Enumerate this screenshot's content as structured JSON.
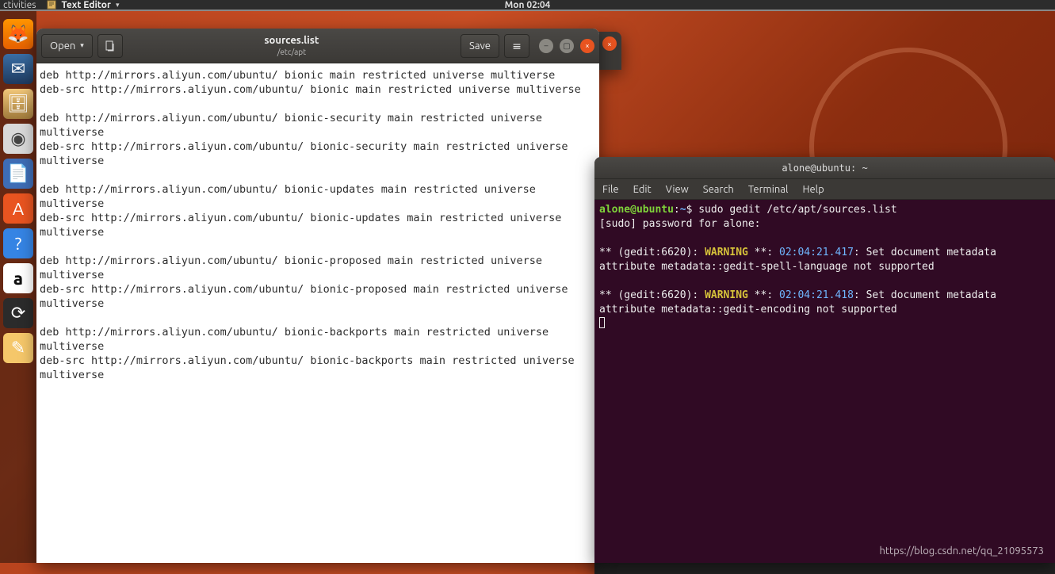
{
  "topbar": {
    "activities": "ctivities",
    "app": "Text Editor",
    "clock": "Mon 02:04"
  },
  "dock": {
    "items": [
      "🦊",
      "✉",
      "🗄",
      "◉",
      "📄",
      "A",
      "?",
      "a",
      "▣",
      "⟳",
      "✎"
    ]
  },
  "gedit": {
    "open_label": "Open",
    "save_label": "Save",
    "filename": "sources.list",
    "filepath": "/etc/apt",
    "content": "deb http://mirrors.aliyun.com/ubuntu/ bionic main restricted universe multiverse\ndeb-src http://mirrors.aliyun.com/ubuntu/ bionic main restricted universe multiverse\n\ndeb http://mirrors.aliyun.com/ubuntu/ bionic-security main restricted universe multiverse\ndeb-src http://mirrors.aliyun.com/ubuntu/ bionic-security main restricted universe multiverse\n\ndeb http://mirrors.aliyun.com/ubuntu/ bionic-updates main restricted universe multiverse\ndeb-src http://mirrors.aliyun.com/ubuntu/ bionic-updates main restricted universe multiverse\n\ndeb http://mirrors.aliyun.com/ubuntu/ bionic-proposed main restricted universe multiverse\ndeb-src http://mirrors.aliyun.com/ubuntu/ bionic-proposed main restricted universe multiverse\n\ndeb http://mirrors.aliyun.com/ubuntu/ bionic-backports main restricted universe multiverse\ndeb-src http://mirrors.aliyun.com/ubuntu/ bionic-backports main restricted universe multiverse\n"
  },
  "terminal": {
    "title": "alone@ubuntu: ~",
    "menu": [
      "File",
      "Edit",
      "View",
      "Search",
      "Terminal",
      "Help"
    ],
    "prompt_user": "alone@ubuntu",
    "prompt_sep": ":",
    "prompt_path": "~",
    "prompt_end": "$",
    "cmd": "sudo gedit /etc/apt/sources.list",
    "sudo_line": "[sudo] password for alone:",
    "warn_prefix": "** (gedit:6620): ",
    "warn_word": "WARNING",
    "warn_mid": " **: ",
    "time1": "02:04:21.417",
    "msg1": ": Set document metadata attribute metadata::gedit-spell-language not supported",
    "time2": "02:04:21.418",
    "msg2": ": Set document metadata attribute metadata::gedit-encoding not supported"
  },
  "watermark": "https://blog.csdn.net/qq_21095573"
}
